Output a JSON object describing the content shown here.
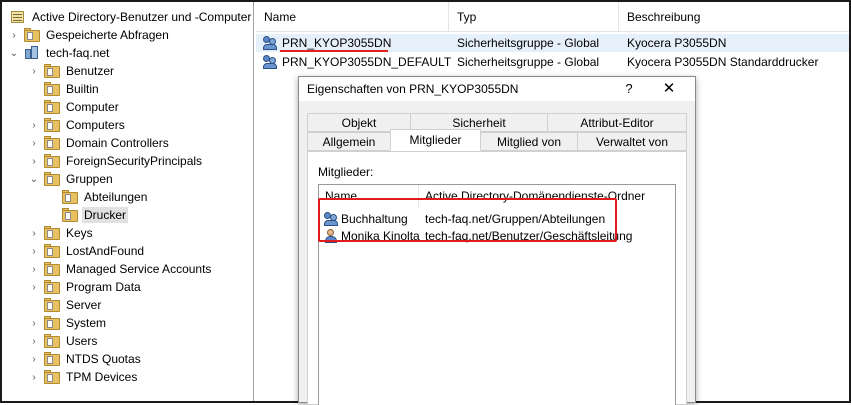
{
  "tree": {
    "root_label": "Active Directory-Benutzer und -Computer",
    "items": [
      {
        "label": "Gespeicherte Abfragen",
        "expander": "›",
        "level": 1,
        "icon": "folder"
      },
      {
        "label": "tech-faq.net",
        "expander": "⌄",
        "level": 1,
        "icon": "domain"
      },
      {
        "label": "Benutzer",
        "expander": "›",
        "level": 2,
        "icon": "folder"
      },
      {
        "label": "Builtin",
        "expander": "",
        "level": 2,
        "icon": "folder"
      },
      {
        "label": "Computer",
        "expander": "",
        "level": 2,
        "icon": "folder"
      },
      {
        "label": "Computers",
        "expander": "›",
        "level": 2,
        "icon": "folder"
      },
      {
        "label": "Domain Controllers",
        "expander": "›",
        "level": 2,
        "icon": "folder"
      },
      {
        "label": "ForeignSecurityPrincipals",
        "expander": "›",
        "level": 2,
        "icon": "folder"
      },
      {
        "label": "Gruppen",
        "expander": "⌄",
        "level": 2,
        "icon": "folder"
      },
      {
        "label": "Abteilungen",
        "expander": "",
        "level": 3,
        "icon": "folder"
      },
      {
        "label": "Drucker",
        "expander": "",
        "level": 3,
        "icon": "folder",
        "selected": true
      },
      {
        "label": "Keys",
        "expander": "›",
        "level": 2,
        "icon": "folder"
      },
      {
        "label": "LostAndFound",
        "expander": "›",
        "level": 2,
        "icon": "folder"
      },
      {
        "label": "Managed Service Accounts",
        "expander": "›",
        "level": 2,
        "icon": "folder"
      },
      {
        "label": "Program Data",
        "expander": "›",
        "level": 2,
        "icon": "folder"
      },
      {
        "label": "Server",
        "expander": "",
        "level": 2,
        "icon": "folder"
      },
      {
        "label": "System",
        "expander": "›",
        "level": 2,
        "icon": "folder"
      },
      {
        "label": "Users",
        "expander": "›",
        "level": 2,
        "icon": "folder"
      },
      {
        "label": "NTDS Quotas",
        "expander": "›",
        "level": 2,
        "icon": "folder"
      },
      {
        "label": "TPM Devices",
        "expander": "›",
        "level": 2,
        "icon": "folder"
      }
    ]
  },
  "list": {
    "columns": [
      "Name",
      "Typ",
      "Beschreibung"
    ],
    "rows": [
      {
        "name": "PRN_KYOP3055DN",
        "type": "Sicherheitsgruppe - Global",
        "description": "Kyocera P3055DN",
        "icon": "group-icon"
      },
      {
        "name": "PRN_KYOP3055DN_DEFAULT",
        "type": "Sicherheitsgruppe - Global",
        "description": "Kyocera P3055DN Standarddrucker",
        "icon": "group-icon"
      }
    ]
  },
  "dialog": {
    "title": "Eigenschaften von PRN_KYOP3055DN",
    "help_glyph": "?",
    "close_glyph": "✕",
    "tabs_row1": [
      "Objekt",
      "Sicherheit",
      "Attribut-Editor"
    ],
    "tabs_row2": [
      "Allgemein",
      "Mitglieder",
      "Mitglied von",
      "Verwaltet von"
    ],
    "active_tab": "Mitglieder",
    "members_label": "Mitglieder:",
    "members_columns": [
      "Name",
      "Active Directory-Domänendienste-Ordner"
    ],
    "members": [
      {
        "name": "Buchhaltung",
        "folder": "tech-faq.net/Gruppen/Abteilungen",
        "icon": "group-icon"
      },
      {
        "name": "Monika Kinolta",
        "folder": "tech-faq.net/Benutzer/Geschäftsleitung",
        "icon": "user-icon"
      }
    ]
  },
  "colors": {
    "highlight_red": "#e01b1b",
    "selected_row": "#e5f0fb",
    "folder_yellow": "#e8c162"
  }
}
